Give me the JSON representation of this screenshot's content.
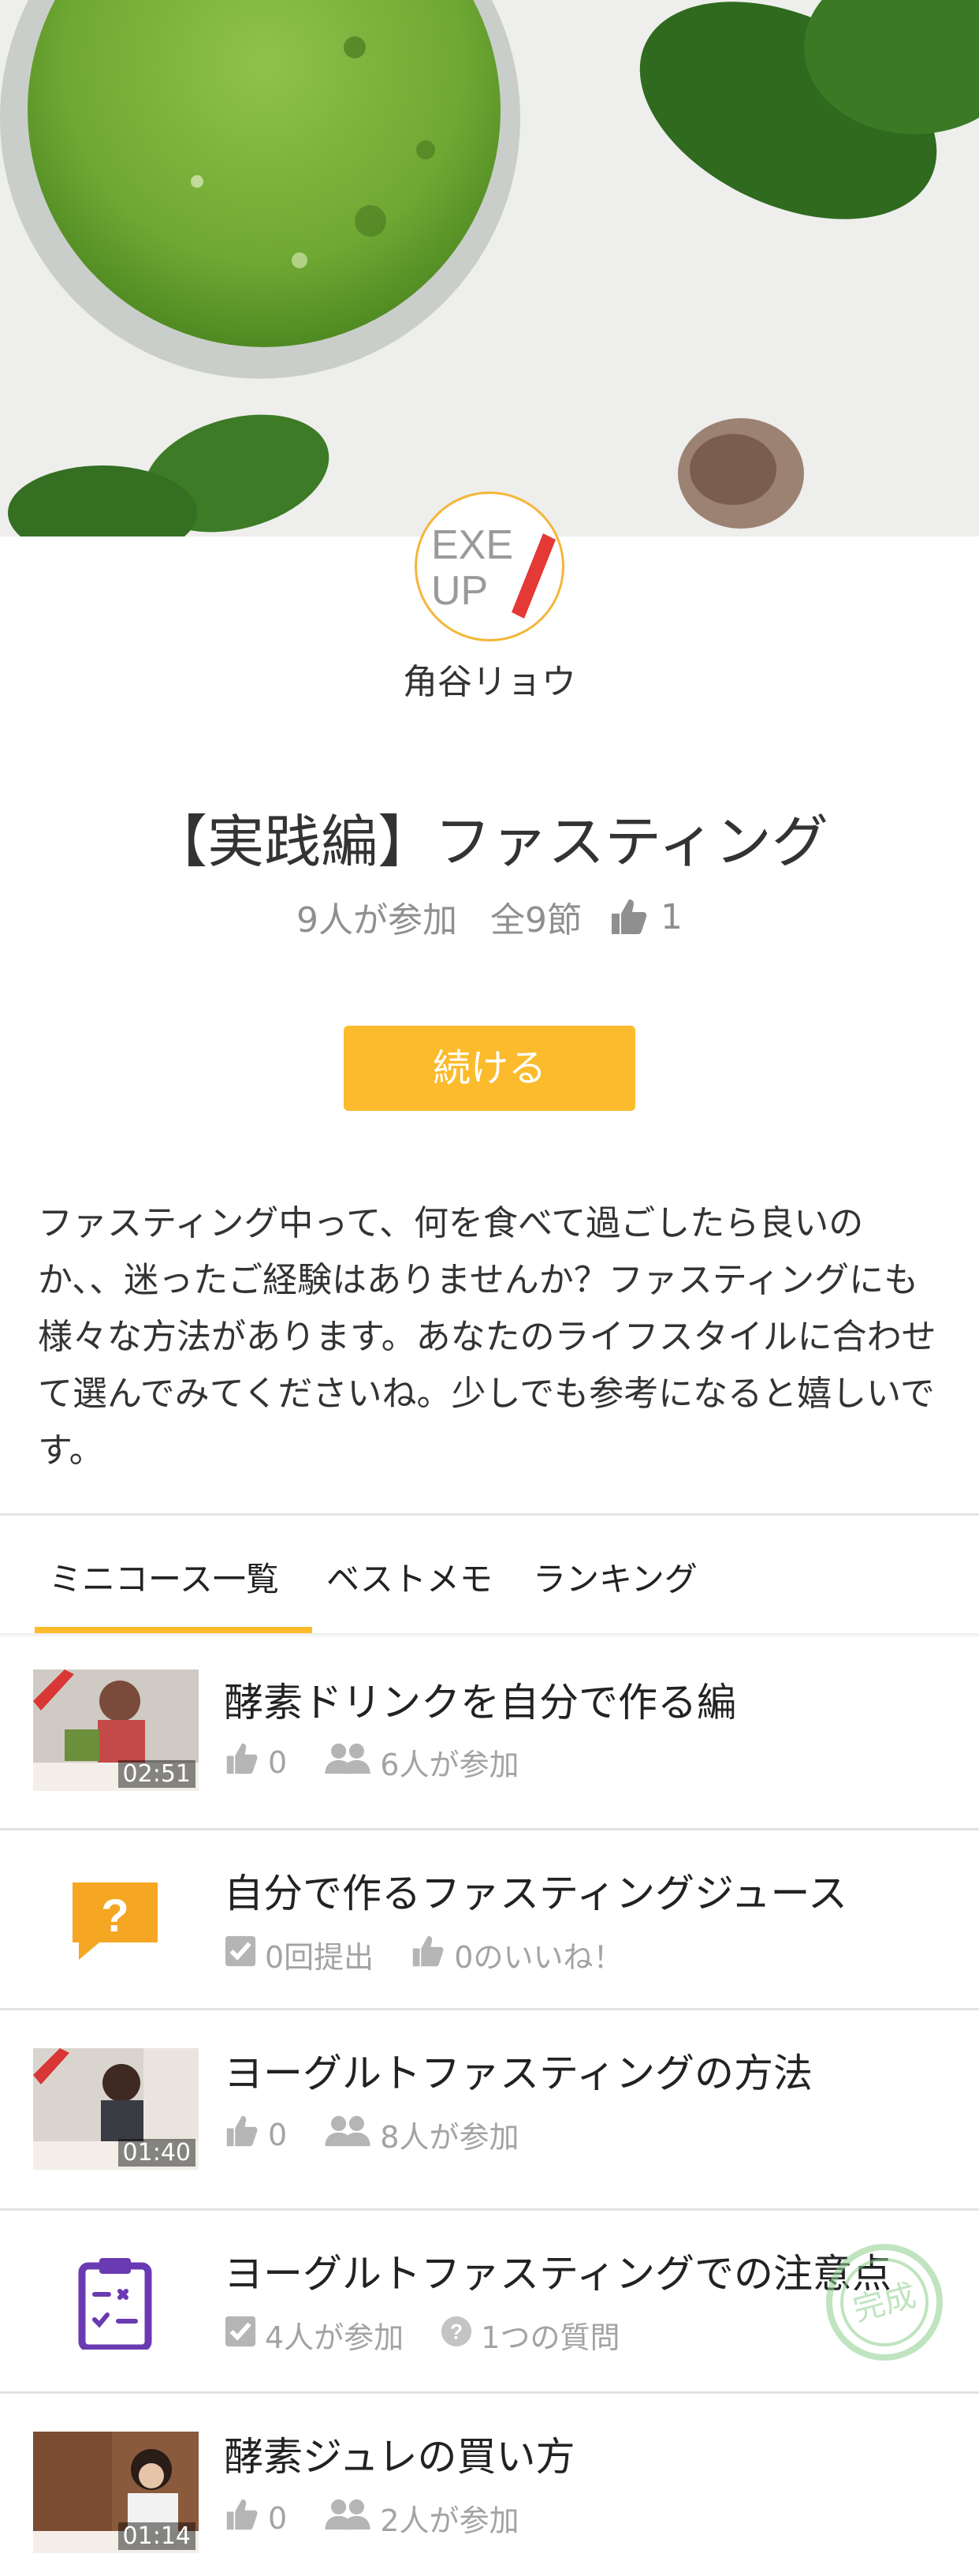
{
  "author": {
    "logo_text_line1": "EXE",
    "logo_text_line2": "UP",
    "name": "角谷リョウ"
  },
  "course": {
    "title": "【実践編】ファスティング",
    "participants": "9人が参加",
    "sections": "全9節",
    "likes": "1",
    "continue_label": "続ける",
    "description": "ファスティング中って、何を食べて過ごしたら良いのか、、迷ったご経験はありませんか？ファスティングにも様々な方法があります。あなたのライフスタイルに合わせて選んでみてくださいね。少しでも参考になると嬉しいです。"
  },
  "tabs": [
    {
      "label": "ミニコース一覧",
      "active": true
    },
    {
      "label": "ベストメモ",
      "active": false
    },
    {
      "label": "ランキング",
      "active": false
    }
  ],
  "items": [
    {
      "type": "video",
      "title": "酵素ドリンクを自分で作る編",
      "duration": "02:51",
      "likes": "0",
      "participants": "6人が参加"
    },
    {
      "type": "quiz",
      "title": "自分で作るファスティングジュース",
      "submitted": "0回提出",
      "likes_text": "0のいいね！"
    },
    {
      "type": "video",
      "title": "ヨーグルトファスティングの方法",
      "duration": "01:40",
      "likes": "0",
      "participants": "8人が参加"
    },
    {
      "type": "checklist",
      "title": "ヨーグルトファスティングでの注意点",
      "participants": "4人が参加",
      "questions": "1つの質問",
      "stamp": "完成"
    },
    {
      "type": "video",
      "title": "酵素ジュレの買い方",
      "duration": "01:14",
      "likes": "0",
      "participants": "2人が参加"
    }
  ],
  "colors": {
    "accent": "#fbbb2c",
    "quiz_icon": "#f5a623",
    "checklist_icon": "#6a3ab2",
    "muted": "#a3a3a3"
  }
}
